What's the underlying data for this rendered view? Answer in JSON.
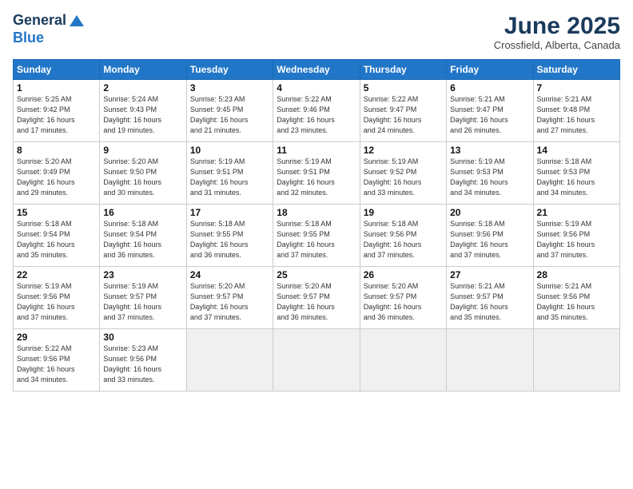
{
  "header": {
    "logo_general": "General",
    "logo_blue": "Blue",
    "month_year": "June 2025",
    "location": "Crossfield, Alberta, Canada"
  },
  "weekdays": [
    "Sunday",
    "Monday",
    "Tuesday",
    "Wednesday",
    "Thursday",
    "Friday",
    "Saturday"
  ],
  "weeks": [
    [
      {
        "day": "1",
        "info": "Sunrise: 5:25 AM\nSunset: 9:42 PM\nDaylight: 16 hours\nand 17 minutes."
      },
      {
        "day": "2",
        "info": "Sunrise: 5:24 AM\nSunset: 9:43 PM\nDaylight: 16 hours\nand 19 minutes."
      },
      {
        "day": "3",
        "info": "Sunrise: 5:23 AM\nSunset: 9:45 PM\nDaylight: 16 hours\nand 21 minutes."
      },
      {
        "day": "4",
        "info": "Sunrise: 5:22 AM\nSunset: 9:46 PM\nDaylight: 16 hours\nand 23 minutes."
      },
      {
        "day": "5",
        "info": "Sunrise: 5:22 AM\nSunset: 9:47 PM\nDaylight: 16 hours\nand 24 minutes."
      },
      {
        "day": "6",
        "info": "Sunrise: 5:21 AM\nSunset: 9:47 PM\nDaylight: 16 hours\nand 26 minutes."
      },
      {
        "day": "7",
        "info": "Sunrise: 5:21 AM\nSunset: 9:48 PM\nDaylight: 16 hours\nand 27 minutes."
      }
    ],
    [
      {
        "day": "8",
        "info": "Sunrise: 5:20 AM\nSunset: 9:49 PM\nDaylight: 16 hours\nand 29 minutes."
      },
      {
        "day": "9",
        "info": "Sunrise: 5:20 AM\nSunset: 9:50 PM\nDaylight: 16 hours\nand 30 minutes."
      },
      {
        "day": "10",
        "info": "Sunrise: 5:19 AM\nSunset: 9:51 PM\nDaylight: 16 hours\nand 31 minutes."
      },
      {
        "day": "11",
        "info": "Sunrise: 5:19 AM\nSunset: 9:51 PM\nDaylight: 16 hours\nand 32 minutes."
      },
      {
        "day": "12",
        "info": "Sunrise: 5:19 AM\nSunset: 9:52 PM\nDaylight: 16 hours\nand 33 minutes."
      },
      {
        "day": "13",
        "info": "Sunrise: 5:19 AM\nSunset: 9:53 PM\nDaylight: 16 hours\nand 34 minutes."
      },
      {
        "day": "14",
        "info": "Sunrise: 5:18 AM\nSunset: 9:53 PM\nDaylight: 16 hours\nand 34 minutes."
      }
    ],
    [
      {
        "day": "15",
        "info": "Sunrise: 5:18 AM\nSunset: 9:54 PM\nDaylight: 16 hours\nand 35 minutes."
      },
      {
        "day": "16",
        "info": "Sunrise: 5:18 AM\nSunset: 9:54 PM\nDaylight: 16 hours\nand 36 minutes."
      },
      {
        "day": "17",
        "info": "Sunrise: 5:18 AM\nSunset: 9:55 PM\nDaylight: 16 hours\nand 36 minutes."
      },
      {
        "day": "18",
        "info": "Sunrise: 5:18 AM\nSunset: 9:55 PM\nDaylight: 16 hours\nand 37 minutes."
      },
      {
        "day": "19",
        "info": "Sunrise: 5:18 AM\nSunset: 9:56 PM\nDaylight: 16 hours\nand 37 minutes."
      },
      {
        "day": "20",
        "info": "Sunrise: 5:18 AM\nSunset: 9:56 PM\nDaylight: 16 hours\nand 37 minutes."
      },
      {
        "day": "21",
        "info": "Sunrise: 5:19 AM\nSunset: 9:56 PM\nDaylight: 16 hours\nand 37 minutes."
      }
    ],
    [
      {
        "day": "22",
        "info": "Sunrise: 5:19 AM\nSunset: 9:56 PM\nDaylight: 16 hours\nand 37 minutes."
      },
      {
        "day": "23",
        "info": "Sunrise: 5:19 AM\nSunset: 9:57 PM\nDaylight: 16 hours\nand 37 minutes."
      },
      {
        "day": "24",
        "info": "Sunrise: 5:20 AM\nSunset: 9:57 PM\nDaylight: 16 hours\nand 37 minutes."
      },
      {
        "day": "25",
        "info": "Sunrise: 5:20 AM\nSunset: 9:57 PM\nDaylight: 16 hours\nand 36 minutes."
      },
      {
        "day": "26",
        "info": "Sunrise: 5:20 AM\nSunset: 9:57 PM\nDaylight: 16 hours\nand 36 minutes."
      },
      {
        "day": "27",
        "info": "Sunrise: 5:21 AM\nSunset: 9:57 PM\nDaylight: 16 hours\nand 35 minutes."
      },
      {
        "day": "28",
        "info": "Sunrise: 5:21 AM\nSunset: 9:56 PM\nDaylight: 16 hours\nand 35 minutes."
      }
    ],
    [
      {
        "day": "29",
        "info": "Sunrise: 5:22 AM\nSunset: 9:56 PM\nDaylight: 16 hours\nand 34 minutes."
      },
      {
        "day": "30",
        "info": "Sunrise: 5:23 AM\nSunset: 9:56 PM\nDaylight: 16 hours\nand 33 minutes."
      },
      {
        "day": "",
        "info": ""
      },
      {
        "day": "",
        "info": ""
      },
      {
        "day": "",
        "info": ""
      },
      {
        "day": "",
        "info": ""
      },
      {
        "day": "",
        "info": ""
      }
    ]
  ]
}
